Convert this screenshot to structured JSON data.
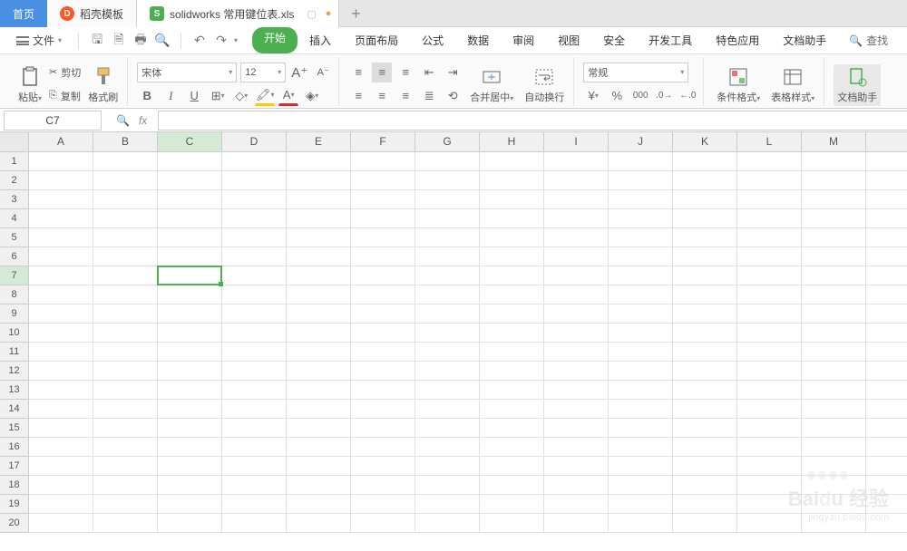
{
  "tabs": {
    "home": "首页",
    "docer": "稻壳模板",
    "file": "solidworks 常用键位表.xls"
  },
  "menu": {
    "file": "文件",
    "items": [
      "开始",
      "插入",
      "页面布局",
      "公式",
      "数据",
      "审阅",
      "视图",
      "安全",
      "开发工具",
      "特色应用",
      "文档助手"
    ],
    "search": "查找"
  },
  "ribbon": {
    "paste": "粘贴",
    "cut": "剪切",
    "copy": "复制",
    "brush": "格式刷",
    "font": "宋体",
    "size": "12",
    "merge": "合并居中",
    "wrap": "自动换行",
    "numfmt": "常规",
    "condfmt": "条件格式",
    "tblstyle": "表格样式",
    "dochelp": "文档助手"
  },
  "cellref": "C7",
  "cols": [
    "A",
    "B",
    "C",
    "D",
    "E",
    "F",
    "G",
    "H",
    "I",
    "J",
    "K",
    "L",
    "M"
  ],
  "selCol": "C",
  "selRow": 7
}
